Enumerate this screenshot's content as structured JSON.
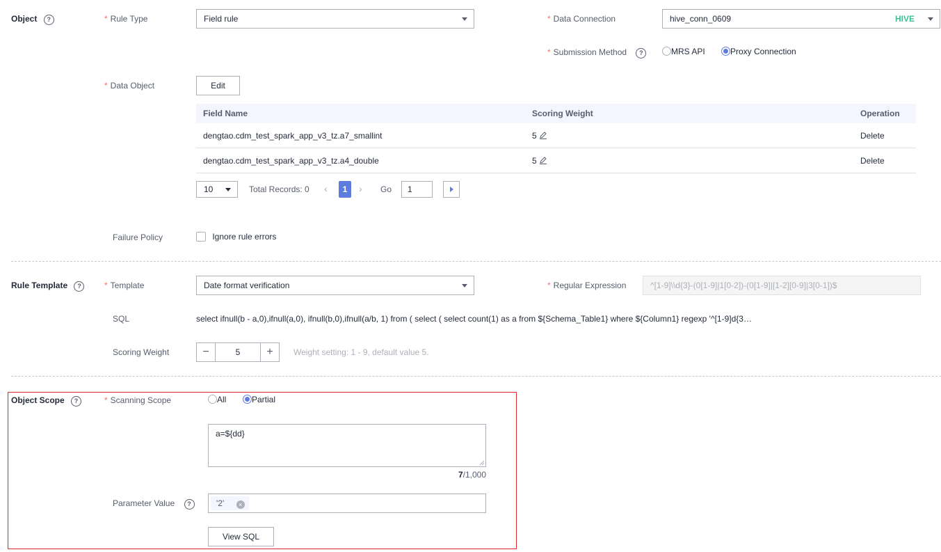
{
  "object": {
    "title": "Object",
    "rule_type_label": "Rule Type",
    "rule_type_value": "Field rule",
    "data_connection_label": "Data Connection",
    "data_connection_value": "hive_conn_0609",
    "data_connection_type": "HIVE",
    "submission_method_label": "Submission Method",
    "submission_options": [
      "MRS API",
      "Proxy Connection"
    ],
    "submission_selected": "Proxy Connection",
    "data_object_label": "Data Object",
    "edit_button": "Edit",
    "table": {
      "headers": [
        "Field Name",
        "Scoring Weight",
        "Operation"
      ],
      "rows": [
        {
          "field": "dengtao.cdm_test_spark_app_v3_tz.a7_smallint",
          "weight": "5",
          "op": "Delete"
        },
        {
          "field": "dengtao.cdm_test_spark_app_v3_tz.a4_double",
          "weight": "5",
          "op": "Delete"
        }
      ]
    },
    "pagination": {
      "page_size": "10",
      "total": "Total Records: 0",
      "current_page": "1",
      "go_label": "Go",
      "go_value": "1"
    },
    "failure_policy_label": "Failure Policy",
    "ignore_errors_label": "Ignore rule errors"
  },
  "rule_template": {
    "title": "Rule Template",
    "template_label": "Template",
    "template_value": "Date format verification",
    "regex_label": "Regular Expression",
    "regex_value": "^[1-9]\\\\d{3}-(0[1-9]|1[0-2])-(0[1-9]|[1-2][0-9]|3[0-1])$",
    "sql_label": "SQL",
    "sql_value": "select ifnull(b - a,0),ifnull(a,0), ifnull(b,0),ifnull(a/b, 1) from ( select ( select count(1) as a from ${Schema_Table1} where ${Column1} regexp '^[1-9]d{3…",
    "scoring_weight_label": "Scoring Weight",
    "scoring_weight_value": "5",
    "weight_hint": "Weight setting: 1 - 9, default value 5."
  },
  "object_scope": {
    "title": "Object Scope",
    "scanning_scope_label": "Scanning Scope",
    "scope_options": [
      "All",
      "Partial"
    ],
    "scope_selected": "Partial",
    "scope_text": "a=${dd}",
    "char_count": "7",
    "char_max": "/1,000",
    "parameter_value_label": "Parameter Value",
    "parameter_tag": "'2'",
    "view_sql_button": "View SQL"
  },
  "colors": {
    "accent": "#5e7ce0",
    "required": "#f66f6a",
    "hive_badge": "#3ac295",
    "highlight_border": "#d9272e"
  }
}
